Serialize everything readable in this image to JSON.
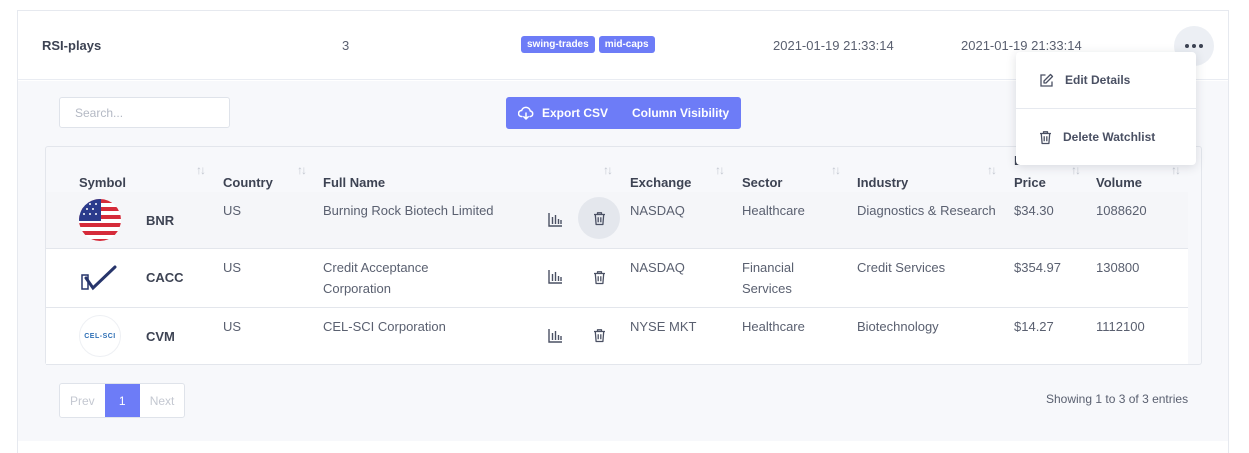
{
  "watchlist": {
    "name": "RSI-plays",
    "count": "3",
    "tags": [
      "swing-trades",
      "mid-caps"
    ],
    "created": "2021-01-19 21:33:14",
    "updated": "2021-01-19 21:33:14"
  },
  "toolbar": {
    "search_placeholder": "Search...",
    "export_label": "Export CSV",
    "visibility_label": "Column Visibility"
  },
  "table": {
    "headers": {
      "symbol": "Symbol",
      "country": "Country",
      "full_name": "Full Name",
      "exchange": "Exchange",
      "sector": "Sector",
      "industry": "Industry",
      "price_top": "L",
      "price": "Price",
      "volume": "Volume"
    },
    "rows": [
      {
        "symbol": "BNR",
        "country": "US",
        "name": "Burning Rock Biotech Limited",
        "exchange": "NASDAQ",
        "sector": "Healthcare",
        "industry": "Diagnostics & Research",
        "price": "$34.30",
        "volume": "1088620",
        "logo": "us-flag"
      },
      {
        "symbol": "CACC",
        "country": "US",
        "name_line1": "Credit Acceptance",
        "name_line2": "Corporation",
        "exchange": "NASDAQ",
        "sector_line1": "Financial",
        "sector_line2": "Services",
        "industry": "Credit Services",
        "price": "$354.97",
        "volume": "130800",
        "logo": "checkmark-logo"
      },
      {
        "symbol": "CVM",
        "country": "US",
        "name": "CEL-SCI Corporation",
        "exchange": "NYSE MKT",
        "sector": "Healthcare",
        "industry": "Biotechnology",
        "price": "$14.27",
        "volume": "1112100",
        "logo": "celsci-logo",
        "logo_text": "CEL-SCI"
      }
    ]
  },
  "pagination": {
    "prev": "Prev",
    "current": "1",
    "next": "Next",
    "info": "Showing 1 to 3 of 3 entries"
  },
  "menu": {
    "edit": "Edit Details",
    "delete": "Delete Watchlist"
  },
  "colors": {
    "accent": "#6d7cf7",
    "text": "#5a6070",
    "heading": "#3d4353"
  }
}
